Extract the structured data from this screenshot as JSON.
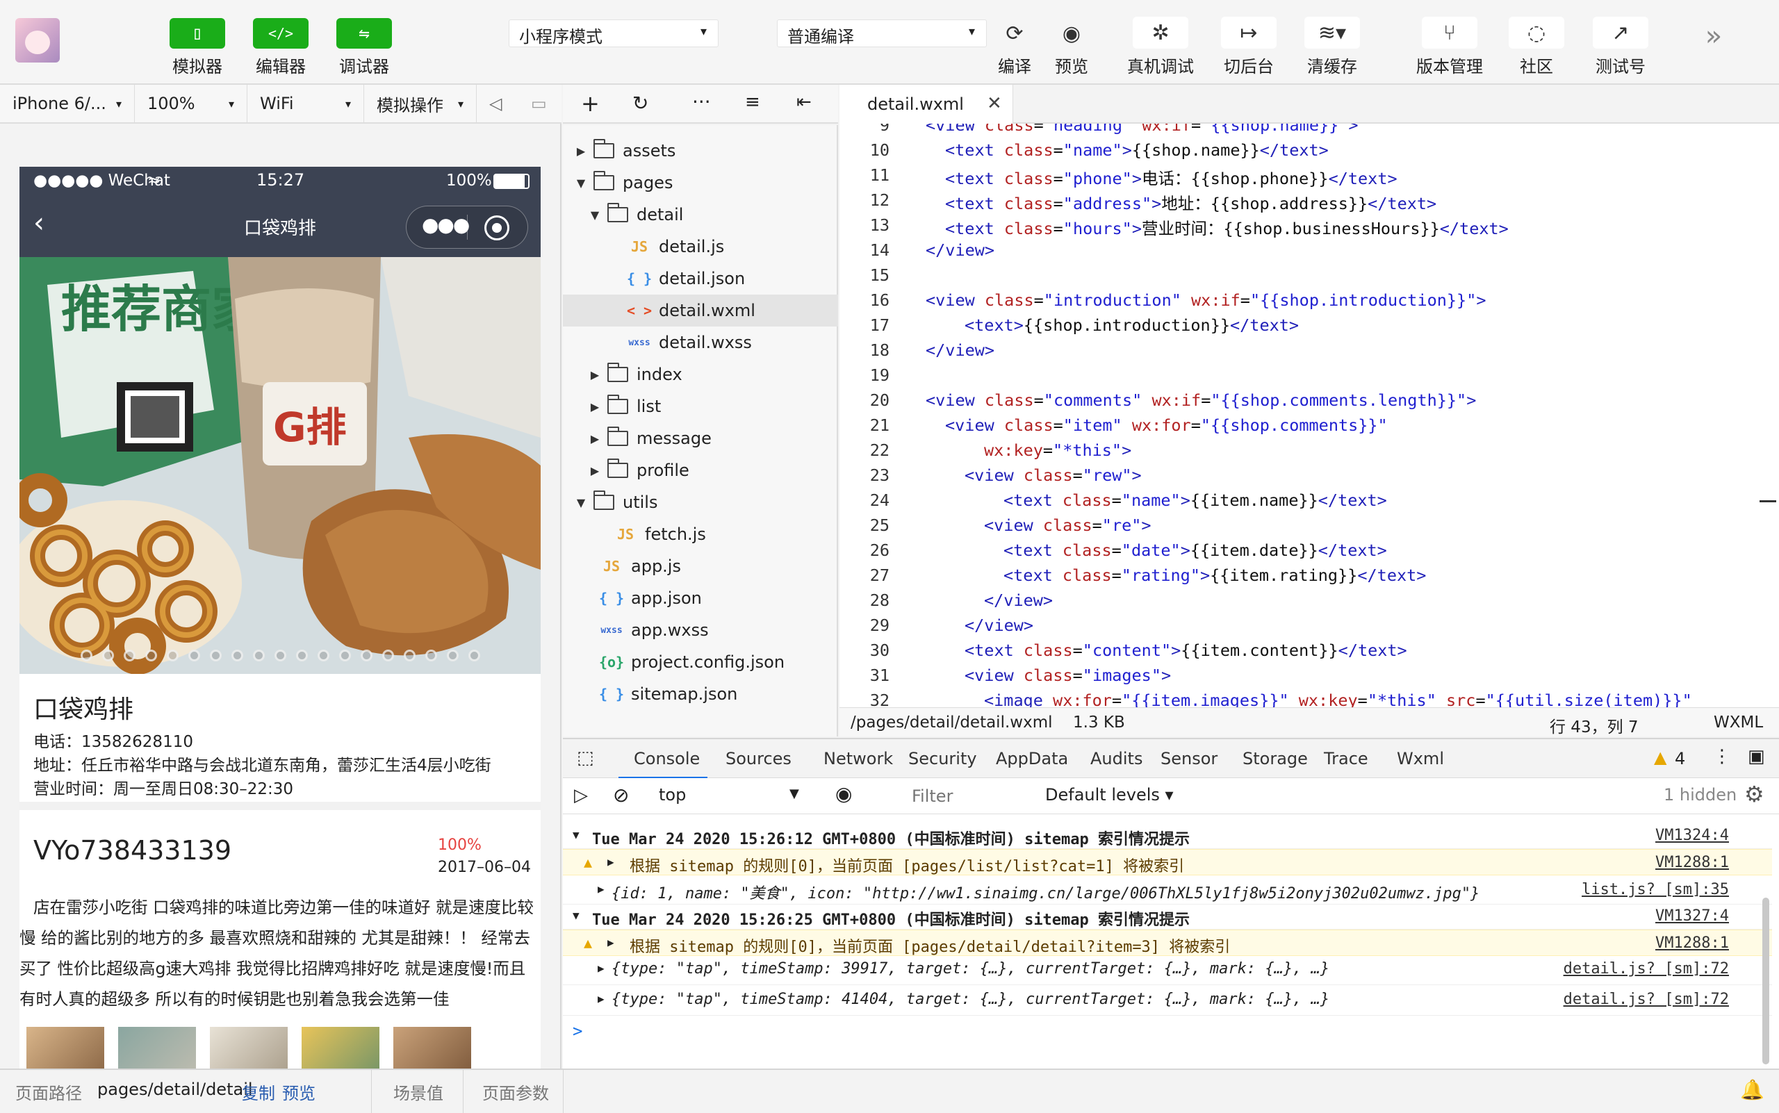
{
  "toolbar": {
    "simulator_label": "模拟器",
    "editor_label": "编辑器",
    "debugger_label": "调试器",
    "mode_select": "小程序模式",
    "compile_select": "普通编译",
    "compile_label": "编译",
    "preview_label": "预览",
    "real_debug_label": "真机调试",
    "background_label": "切后台",
    "clear_cache_label": "清缓存",
    "version_label": "版本管理",
    "community_label": "社区",
    "test_account_label": "测试号",
    "more_glyph": "»"
  },
  "sim_controls": {
    "device": "iPhone 6/...",
    "zoom": "100%",
    "network": "WiFi",
    "operation": "模拟操作"
  },
  "phone": {
    "status_carrier": "●●●●● WeChat",
    "status_time": "15:27",
    "status_battery": "100%",
    "nav_title": "口袋鸡排",
    "shop_name": "口袋鸡排",
    "shop_phone": "电话：13582628110",
    "shop_address": "地址：任丘市裕华中路与会战北道东南角，蕾莎汇生活4层小吃街",
    "shop_hours": "营业时间：周一至周日08:30–22:30",
    "hero_text": "推荐商家",
    "hero_logo": "G排",
    "comment_user": "VYo738433139",
    "comment_rating": "100%",
    "comment_date": "2017–06–04",
    "comment_text": "店在雷莎小吃街 口袋鸡排的味道比旁边第一佳的味道好 就是速度比较慢 给的酱比别的地方的多 最喜欢照烧和甜辣的 尤其是甜辣！！ 经常去买了 性价比超级高g速大鸡排 我觉得比招牌鸡排好吃 就是速度慢!而且有时人真的超级多 所以有的时候钥匙也别着急我会选第一佳"
  },
  "file_tree": {
    "items": [
      {
        "label": "assets",
        "type": "folder"
      },
      {
        "label": "pages",
        "type": "folder"
      },
      {
        "label": "detail",
        "type": "folder"
      },
      {
        "label": "detail.js",
        "type": "js"
      },
      {
        "label": "detail.json",
        "type": "json"
      },
      {
        "label": "detail.wxml",
        "type": "wxml"
      },
      {
        "label": "detail.wxss",
        "type": "wxss"
      },
      {
        "label": "index",
        "type": "folder"
      },
      {
        "label": "list",
        "type": "folder"
      },
      {
        "label": "message",
        "type": "folder"
      },
      {
        "label": "profile",
        "type": "folder"
      },
      {
        "label": "utils",
        "type": "folder"
      },
      {
        "label": "fetch.js",
        "type": "js"
      },
      {
        "label": "app.js",
        "type": "js"
      },
      {
        "label": "app.json",
        "type": "json"
      },
      {
        "label": "app.wxss",
        "type": "wxss"
      },
      {
        "label": "project.config.json",
        "type": "config"
      },
      {
        "label": "sitemap.json",
        "type": "json"
      }
    ],
    "icons": {
      "js": "JS",
      "json": "{ }",
      "wxml": "< >",
      "wxss": "wxss",
      "config": "{o}"
    }
  },
  "editor": {
    "tab_name": "detail.wxml",
    "lines": [
      {
        "n": "9",
        "indent": 0,
        "parts": [
          [
            "tg",
            "<view "
          ],
          [
            "at",
            "class"
          ],
          [
            "tx",
            "="
          ],
          [
            "st",
            "\"heading\" "
          ],
          [
            "at",
            "wx:if"
          ],
          [
            "tx",
            "="
          ],
          [
            "st",
            "\"{{shop.name}}\""
          ],
          [
            "tg",
            ">"
          ]
        ]
      },
      {
        "n": "10",
        "indent": 1,
        "parts": [
          [
            "tg",
            "<text "
          ],
          [
            "at",
            "class"
          ],
          [
            "tx",
            "="
          ],
          [
            "st",
            "\"name\""
          ],
          [
            "tg",
            ">"
          ],
          [
            "tx",
            "{{shop.name}}"
          ],
          [
            "tg",
            "</text>"
          ]
        ]
      },
      {
        "n": "11",
        "indent": 1,
        "parts": [
          [
            "tg",
            "<text "
          ],
          [
            "at",
            "class"
          ],
          [
            "tx",
            "="
          ],
          [
            "st",
            "\"phone\""
          ],
          [
            "tg",
            ">"
          ],
          [
            "tx",
            "电话：{{shop.phone}}"
          ],
          [
            "tg",
            "</text>"
          ]
        ]
      },
      {
        "n": "12",
        "indent": 1,
        "parts": [
          [
            "tg",
            "<text "
          ],
          [
            "at",
            "class"
          ],
          [
            "tx",
            "="
          ],
          [
            "st",
            "\"address\""
          ],
          [
            "tg",
            ">"
          ],
          [
            "tx",
            "地址：{{shop.address}}"
          ],
          [
            "tg",
            "</text>"
          ]
        ]
      },
      {
        "n": "13",
        "indent": 1,
        "parts": [
          [
            "tg",
            "<text "
          ],
          [
            "at",
            "class"
          ],
          [
            "tx",
            "="
          ],
          [
            "st",
            "\"hours\""
          ],
          [
            "tg",
            ">"
          ],
          [
            "tx",
            "营业时间：{{shop.businessHours}}"
          ],
          [
            "tg",
            "</text>"
          ]
        ]
      },
      {
        "n": "14",
        "indent": 0,
        "parts": [
          [
            "tg",
            "</view>"
          ]
        ]
      },
      {
        "n": "15",
        "indent": 0,
        "parts": []
      },
      {
        "n": "16",
        "indent": 0,
        "parts": [
          [
            "tg",
            "<view "
          ],
          [
            "at",
            "class"
          ],
          [
            "tx",
            "="
          ],
          [
            "st",
            "\"introduction\" "
          ],
          [
            "at",
            "wx:if"
          ],
          [
            "tx",
            "="
          ],
          [
            "st",
            "\"{{shop.introduction}}\""
          ],
          [
            "tg",
            ">"
          ]
        ]
      },
      {
        "n": "17",
        "indent": 2,
        "parts": [
          [
            "tg",
            "<text>"
          ],
          [
            "tx",
            "{{shop.introduction}}"
          ],
          [
            "tg",
            "</text>"
          ]
        ]
      },
      {
        "n": "18",
        "indent": 0,
        "parts": [
          [
            "tg",
            "</view>"
          ]
        ]
      },
      {
        "n": "19",
        "indent": 0,
        "parts": []
      },
      {
        "n": "20",
        "indent": 0,
        "parts": [
          [
            "tg",
            "<view "
          ],
          [
            "at",
            "class"
          ],
          [
            "tx",
            "="
          ],
          [
            "st",
            "\"comments\" "
          ],
          [
            "at",
            "wx:if"
          ],
          [
            "tx",
            "="
          ],
          [
            "st",
            "\"{{shop.comments.length}}\""
          ],
          [
            "tg",
            ">"
          ]
        ]
      },
      {
        "n": "21",
        "indent": 1,
        "parts": [
          [
            "tg",
            "<view "
          ],
          [
            "at",
            "class"
          ],
          [
            "tx",
            "="
          ],
          [
            "st",
            "\"item\" "
          ],
          [
            "at",
            "wx:for"
          ],
          [
            "tx",
            "="
          ],
          [
            "st",
            "\"{{shop.comments}}\""
          ]
        ]
      },
      {
        "n": "22",
        "indent": 3,
        "parts": [
          [
            "at",
            "wx:key"
          ],
          [
            "tx",
            "="
          ],
          [
            "st",
            "\"*this\""
          ],
          [
            "tg",
            ">"
          ]
        ]
      },
      {
        "n": "23",
        "indent": 2,
        "parts": [
          [
            "tg",
            "<view "
          ],
          [
            "at",
            "class"
          ],
          [
            "tx",
            "="
          ],
          [
            "st",
            "\"rew\""
          ],
          [
            "tg",
            ">"
          ]
        ]
      },
      {
        "n": "24",
        "indent": 4,
        "parts": [
          [
            "tg",
            "<text "
          ],
          [
            "at",
            "class"
          ],
          [
            "tx",
            "="
          ],
          [
            "st",
            "\"name\""
          ],
          [
            "tg",
            ">"
          ],
          [
            "tx",
            "{{item.name}}"
          ],
          [
            "tg",
            "</text>"
          ]
        ]
      },
      {
        "n": "25",
        "indent": 3,
        "parts": [
          [
            "tg",
            "<view "
          ],
          [
            "at",
            "class"
          ],
          [
            "tx",
            "="
          ],
          [
            "st",
            "\"re\""
          ],
          [
            "tg",
            ">"
          ]
        ]
      },
      {
        "n": "26",
        "indent": 4,
        "parts": [
          [
            "tg",
            "<text "
          ],
          [
            "at",
            "class"
          ],
          [
            "tx",
            "="
          ],
          [
            "st",
            "\"date\""
          ],
          [
            "tg",
            ">"
          ],
          [
            "tx",
            "{{item.date}}"
          ],
          [
            "tg",
            "</text>"
          ]
        ]
      },
      {
        "n": "27",
        "indent": 4,
        "parts": [
          [
            "tg",
            "<text "
          ],
          [
            "at",
            "class"
          ],
          [
            "tx",
            "="
          ],
          [
            "st",
            "\"rating\""
          ],
          [
            "tg",
            ">"
          ],
          [
            "tx",
            "{{item.rating}}"
          ],
          [
            "tg",
            "</text>"
          ]
        ]
      },
      {
        "n": "28",
        "indent": 3,
        "parts": [
          [
            "tg",
            "</view>"
          ]
        ]
      },
      {
        "n": "29",
        "indent": 2,
        "parts": [
          [
            "tg",
            "</view>"
          ]
        ]
      },
      {
        "n": "30",
        "indent": 2,
        "parts": [
          [
            "tg",
            "<text "
          ],
          [
            "at",
            "class"
          ],
          [
            "tx",
            "="
          ],
          [
            "st",
            "\"content\""
          ],
          [
            "tg",
            ">"
          ],
          [
            "tx",
            "{{item.content}}"
          ],
          [
            "tg",
            "</text>"
          ]
        ]
      },
      {
        "n": "31",
        "indent": 2,
        "parts": [
          [
            "tg",
            "<view "
          ],
          [
            "at",
            "class"
          ],
          [
            "tx",
            "="
          ],
          [
            "st",
            "\"images\""
          ],
          [
            "tg",
            ">"
          ]
        ]
      },
      {
        "n": "32",
        "indent": 3,
        "parts": [
          [
            "tg",
            "<image "
          ],
          [
            "at",
            "wx:for"
          ],
          [
            "tx",
            "="
          ],
          [
            "st",
            "\"{{item.images}}\" "
          ],
          [
            "at",
            "wx:key"
          ],
          [
            "tx",
            "="
          ],
          [
            "st",
            "\"*this\" "
          ],
          [
            "at",
            "src"
          ],
          [
            "tx",
            "="
          ],
          [
            "st",
            "\"{{util.size(item)}}\""
          ]
        ]
      }
    ],
    "status_path": "/pages/detail/detail.wxml",
    "status_size": "1.3 KB",
    "status_pos": "行 43，列 7",
    "status_lang": "WXML"
  },
  "devtools": {
    "tabs": [
      "Console",
      "Sources",
      "Network",
      "Security",
      "AppData",
      "Audits",
      "Sensor",
      "Storage",
      "Trace",
      "Wxml"
    ],
    "warn_count": "4",
    "context": "top",
    "filter_placeholder": "Filter",
    "levels": "Default levels ▾",
    "hidden": "1 hidden",
    "rows": [
      {
        "kind": "group",
        "text": "Tue Mar 24 2020 15:26:12 GMT+0800 (中国标准时间) sitemap 索引情况提示",
        "link": "VM1324:4"
      },
      {
        "kind": "warn",
        "text": "根据 sitemap 的规则[0]，当前页面 [pages/list/list?cat=1] 将被索引",
        "link": "VM1288:1"
      },
      {
        "kind": "obj",
        "text": "{id: 1, name: \"美食\", icon: \"http://ww1.sinaimg.cn/large/006ThXL5ly1fj8w5i2onyj302u02umwz.jpg\"}",
        "link": "list.js? [sm]:35"
      },
      {
        "kind": "group",
        "text": "Tue Mar 24 2020 15:26:25 GMT+0800 (中国标准时间) sitemap 索引情况提示",
        "link": "VM1327:4"
      },
      {
        "kind": "warn",
        "text": "根据 sitemap 的规则[0]，当前页面 [pages/detail/detail?item=3] 将被索引",
        "link": "VM1288:1"
      },
      {
        "kind": "obj",
        "text": "{type: \"tap\", timeStamp: 39917, target: {…}, currentTarget: {…}, mark: {…}, …}",
        "link": "detail.js? [sm]:72"
      },
      {
        "kind": "obj",
        "text": "{type: \"tap\", timeStamp: 41404, target: {…}, currentTarget: {…}, mark: {…}, …}",
        "link": "detail.js? [sm]:72"
      }
    ],
    "prompt": ">"
  },
  "bottom": {
    "path_label": "页面路径",
    "path_value": "pages/detail/detail",
    "copy": "复制",
    "preview": "预览",
    "scene": "场景值",
    "params": "页面参数"
  },
  "colors": {
    "green": "#1aad19",
    "nav_dark": "#3c4353",
    "rating_red": "#e64340",
    "warn_bg": "#fffbe5"
  }
}
